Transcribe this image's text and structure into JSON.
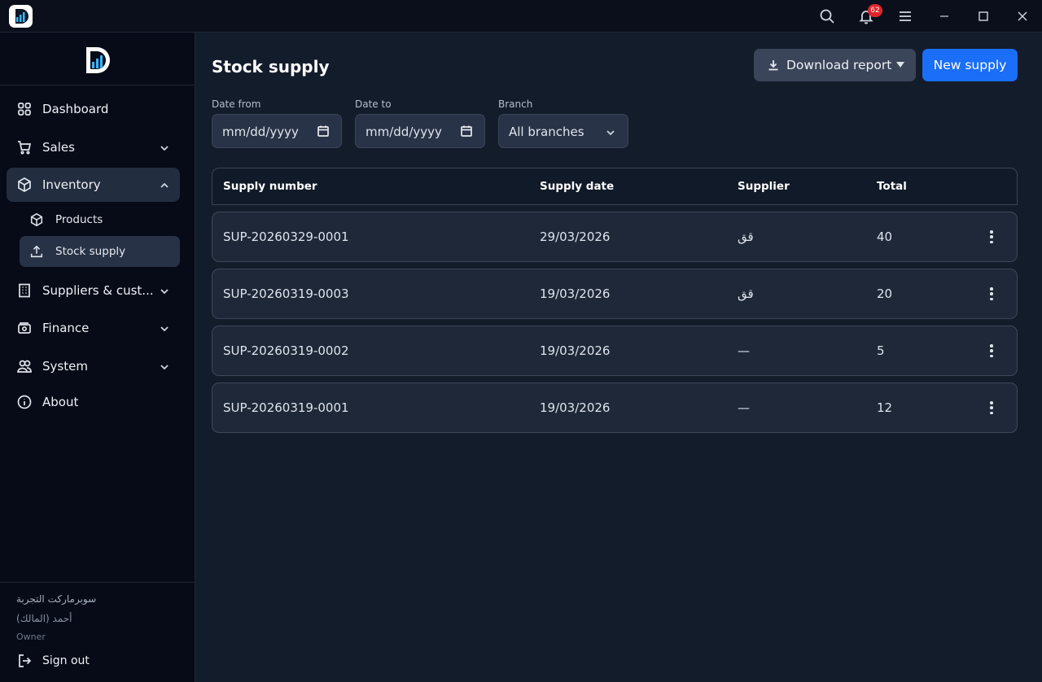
{
  "titlebar": {
    "notifications_count": "62",
    "icons": [
      "search-icon",
      "bell-icon",
      "menu-icon",
      "minimize-icon",
      "maximize-icon",
      "close-icon"
    ]
  },
  "sidebar": {
    "items": [
      {
        "label": "Dashboard",
        "icon": "grid-icon"
      },
      {
        "label": "Sales",
        "icon": "cart-icon"
      },
      {
        "label": "Inventory",
        "icon": "box-icon"
      },
      {
        "label": "Suppliers & cust...",
        "icon": "building-icon"
      },
      {
        "label": "Finance",
        "icon": "money-icon"
      },
      {
        "label": "System",
        "icon": "users-icon"
      },
      {
        "label": "About",
        "icon": "info-icon"
      }
    ],
    "inventory_sub": [
      {
        "label": "Products",
        "icon": "box-icon"
      },
      {
        "label": "Stock supply",
        "icon": "upload-icon"
      }
    ],
    "store_name": "سوبرماركت التجربة",
    "user_name": "أحمد (المالك)",
    "user_role": "Owner",
    "signout_label": "Sign out"
  },
  "main": {
    "title": "Stock supply",
    "download_label": "Download report",
    "new_label": "New supply",
    "filters": {
      "date_from_label": "Date from",
      "date_from_value": "mm/dd/yyyy",
      "date_to_label": "Date to",
      "date_to_value": "mm/dd/yyyy",
      "branch_label": "Branch",
      "branch_value": "All branches"
    },
    "table": {
      "headers": [
        "Supply number",
        "Supply date",
        "Supplier",
        "Total"
      ],
      "rows": [
        {
          "number": "SUP-20260329-0001",
          "date": "29/03/2026",
          "supplier": "قق",
          "total": "40"
        },
        {
          "number": "SUP-20260319-0003",
          "date": "19/03/2026",
          "supplier": "قق",
          "total": "20"
        },
        {
          "number": "SUP-20260319-0002",
          "date": "19/03/2026",
          "supplier": "—",
          "total": "5"
        },
        {
          "number": "SUP-20260319-0001",
          "date": "19/03/2026",
          "supplier": "—",
          "total": "12"
        }
      ]
    }
  },
  "colors": {
    "accent": "#1a6ef7",
    "badge": "#e0242b",
    "sidebar_bg": "#070b17",
    "main_bg": "#131c2b"
  }
}
